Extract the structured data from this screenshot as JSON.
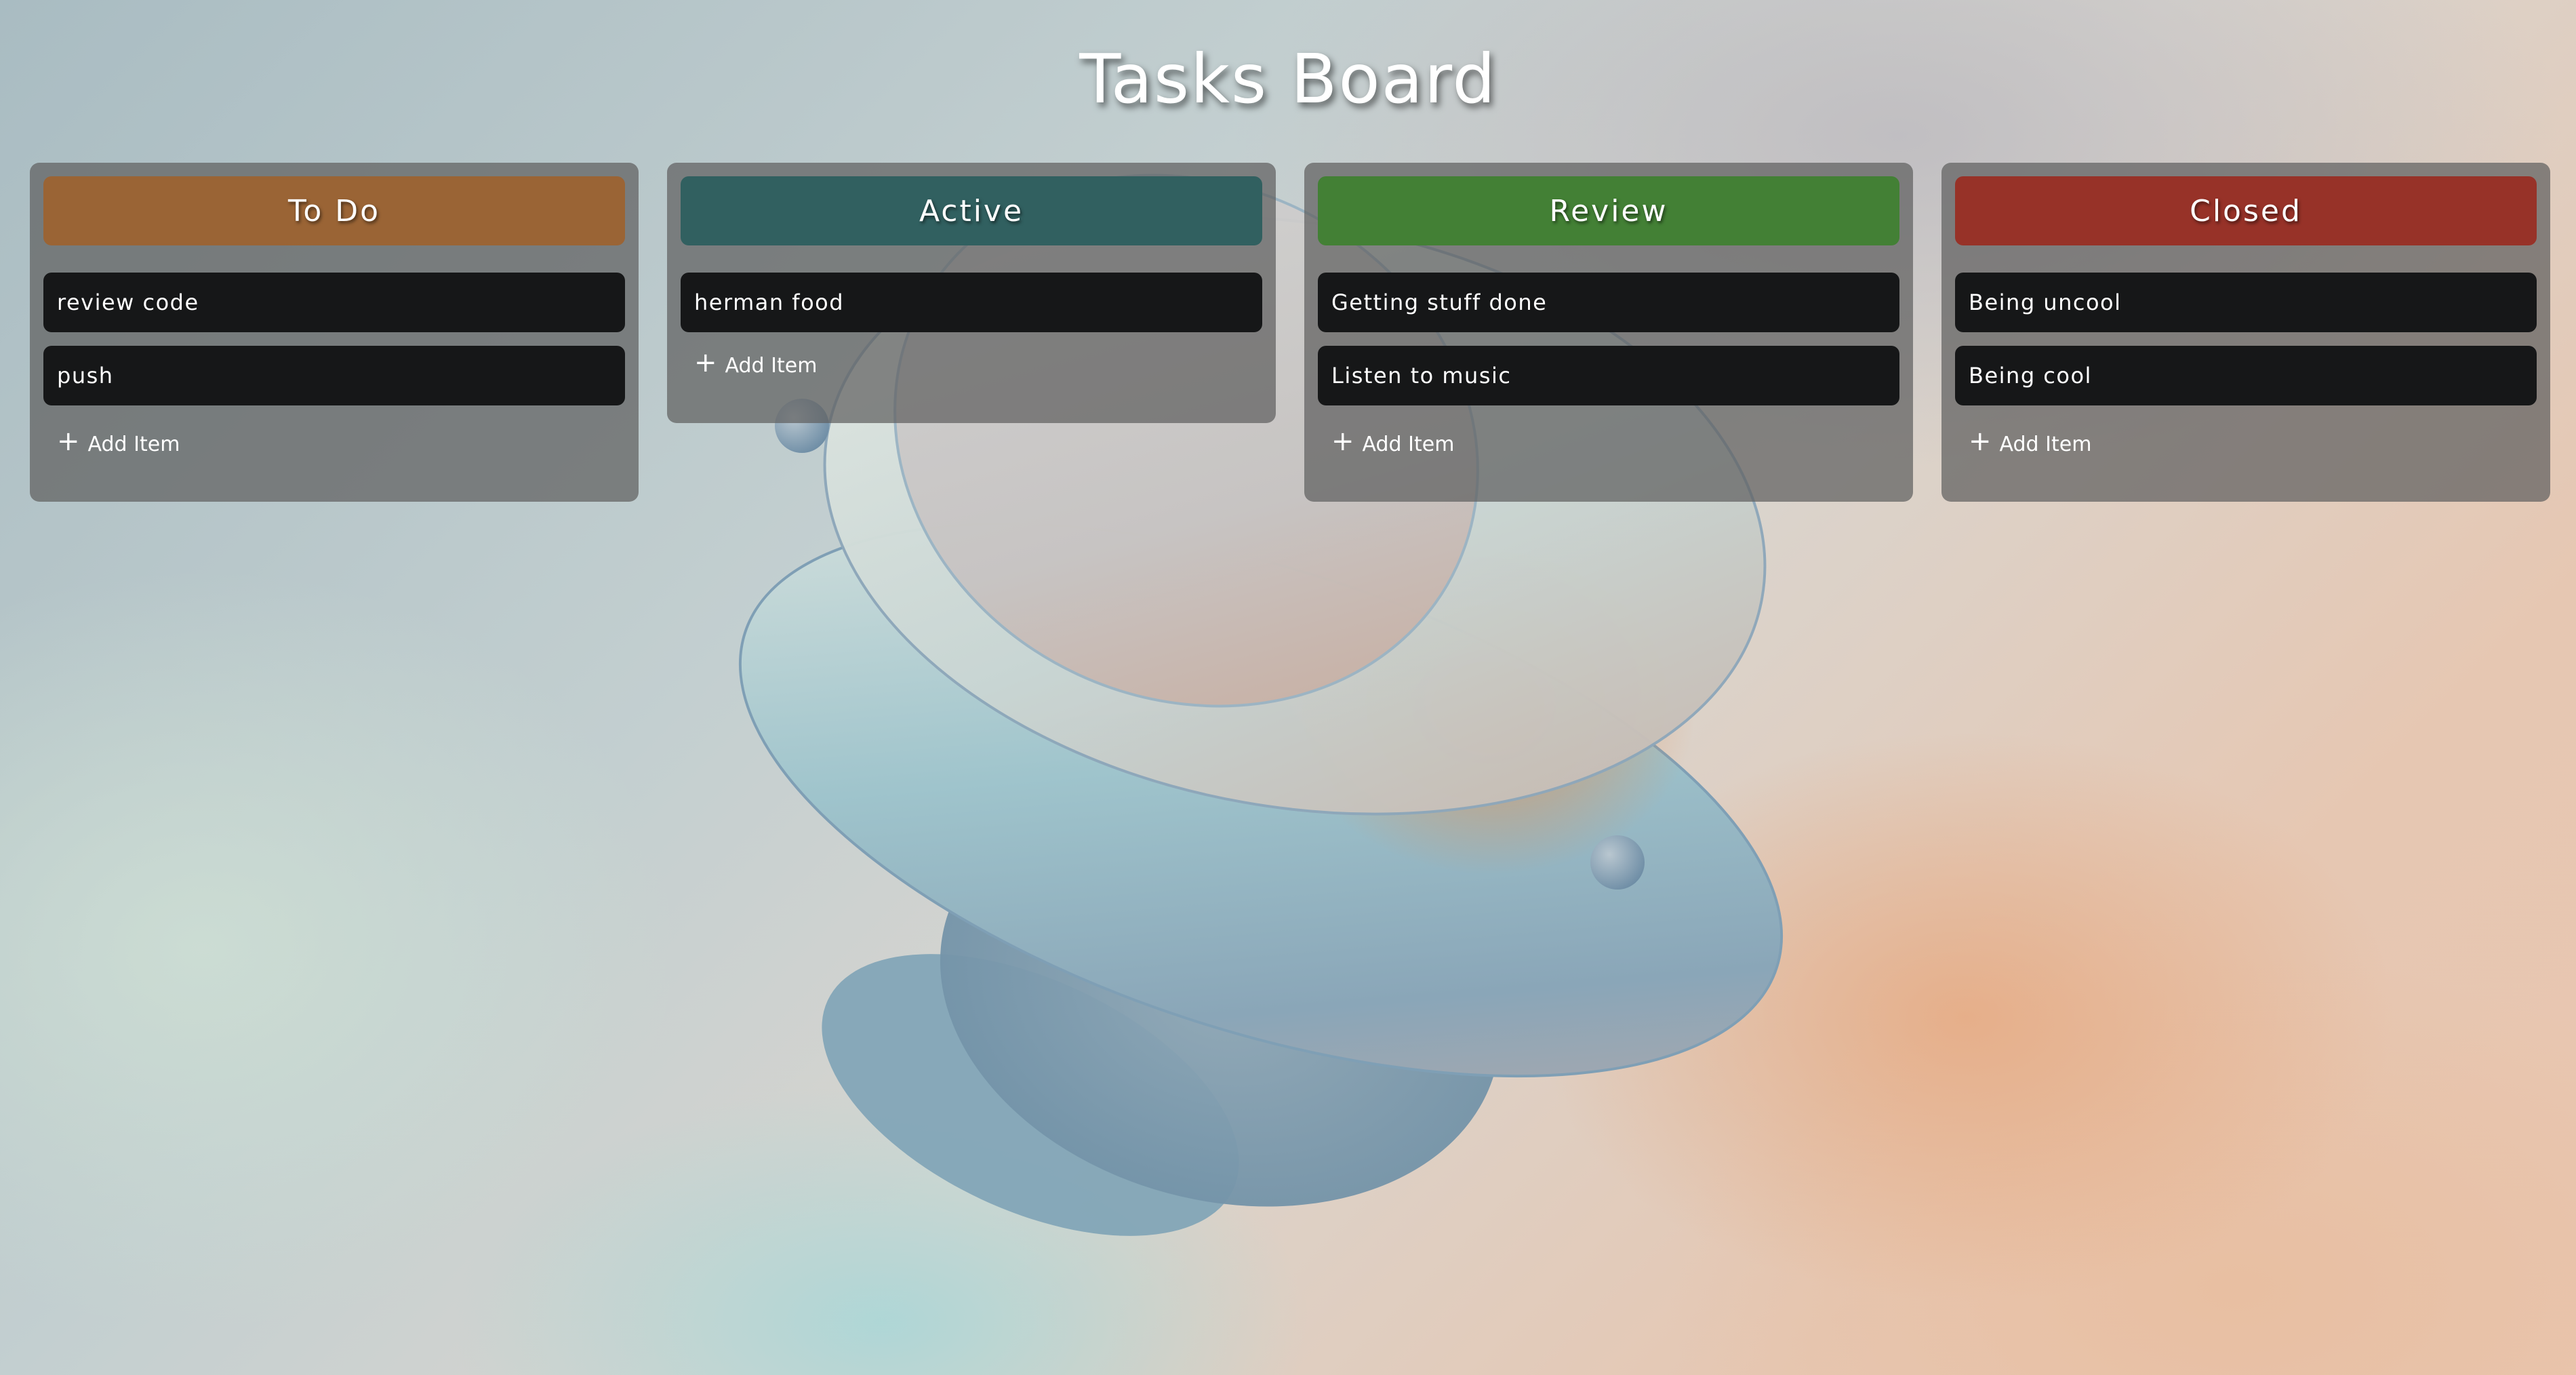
{
  "board": {
    "title": "Tasks Board"
  },
  "columns": [
    {
      "id": "todo",
      "label": "To Do",
      "color": "#9a6435",
      "items": [
        "review code",
        "push"
      ]
    },
    {
      "id": "active",
      "label": "Active",
      "color": "#316060",
      "items": [
        "herman food"
      ]
    },
    {
      "id": "review",
      "label": "Review",
      "color": "#438035",
      "items": [
        "Getting stuff done",
        "Listen to music"
      ]
    },
    {
      "id": "closed",
      "label": "Closed",
      "color": "#973228",
      "items": [
        "Being uncool",
        "Being cool"
      ]
    }
  ],
  "actions": {
    "add_item_label": "Add Item",
    "add_item_icon": "plus-icon"
  }
}
